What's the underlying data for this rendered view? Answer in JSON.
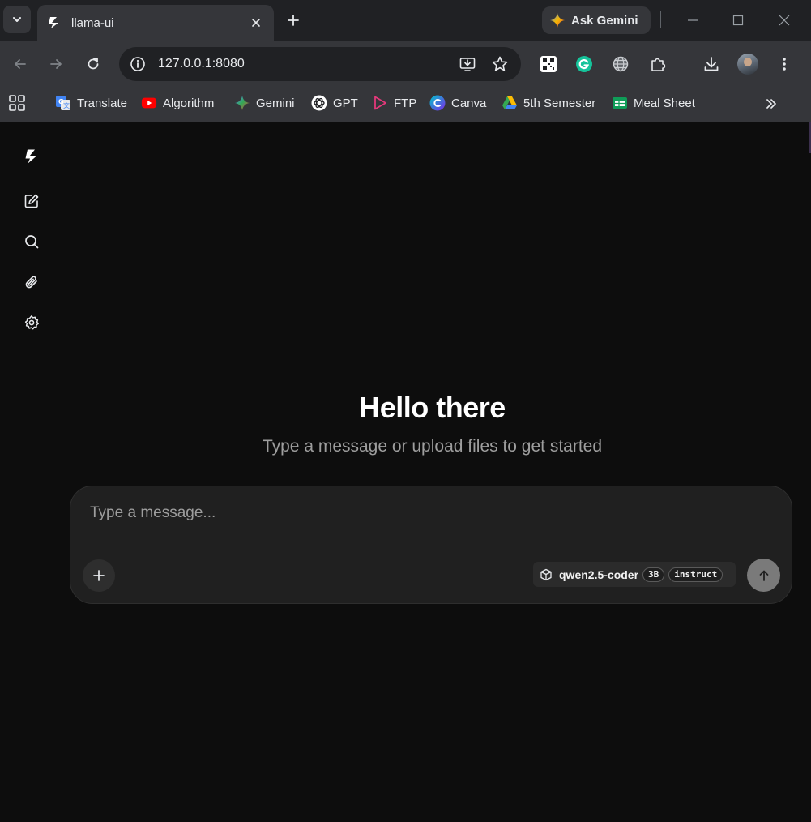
{
  "browser": {
    "tab": {
      "title": "llama-ui"
    },
    "ask_gemini": "Ask Gemini",
    "url": "127.0.0.1:8080",
    "bookmarks": [
      {
        "label": "Translate",
        "icon": "google-translate-icon",
        "color": "#4285f4"
      },
      {
        "label": "Algorithm",
        "icon": "youtube-icon",
        "color": "#ff0000"
      },
      {
        "label": "Gemini",
        "icon": "gemini-icon",
        "color": "#4e8cff"
      },
      {
        "label": "GPT",
        "icon": "openai-icon",
        "color": "#ffffff"
      },
      {
        "label": "FTP",
        "icon": "play-outline-icon",
        "color": "#e3387a"
      },
      {
        "label": "Canva",
        "icon": "canva-icon",
        "color": "#7d2ae8"
      },
      {
        "label": "5th Semester",
        "icon": "google-drive-icon",
        "color": "#34a853"
      },
      {
        "label": "Meal Sheet",
        "icon": "google-sheets-icon",
        "color": "#0f9d58"
      }
    ]
  },
  "app": {
    "sidebar": [
      "logo-icon",
      "new-chat-icon",
      "search-icon",
      "attachments-icon",
      "settings-icon"
    ],
    "greeting": {
      "title": "Hello there",
      "subtitle": "Type a message or upload files to get started"
    },
    "composer": {
      "placeholder": "Type a message...",
      "model": {
        "name": "qwen2.5-coder",
        "badges": [
          "3B",
          "instruct"
        ]
      }
    }
  }
}
